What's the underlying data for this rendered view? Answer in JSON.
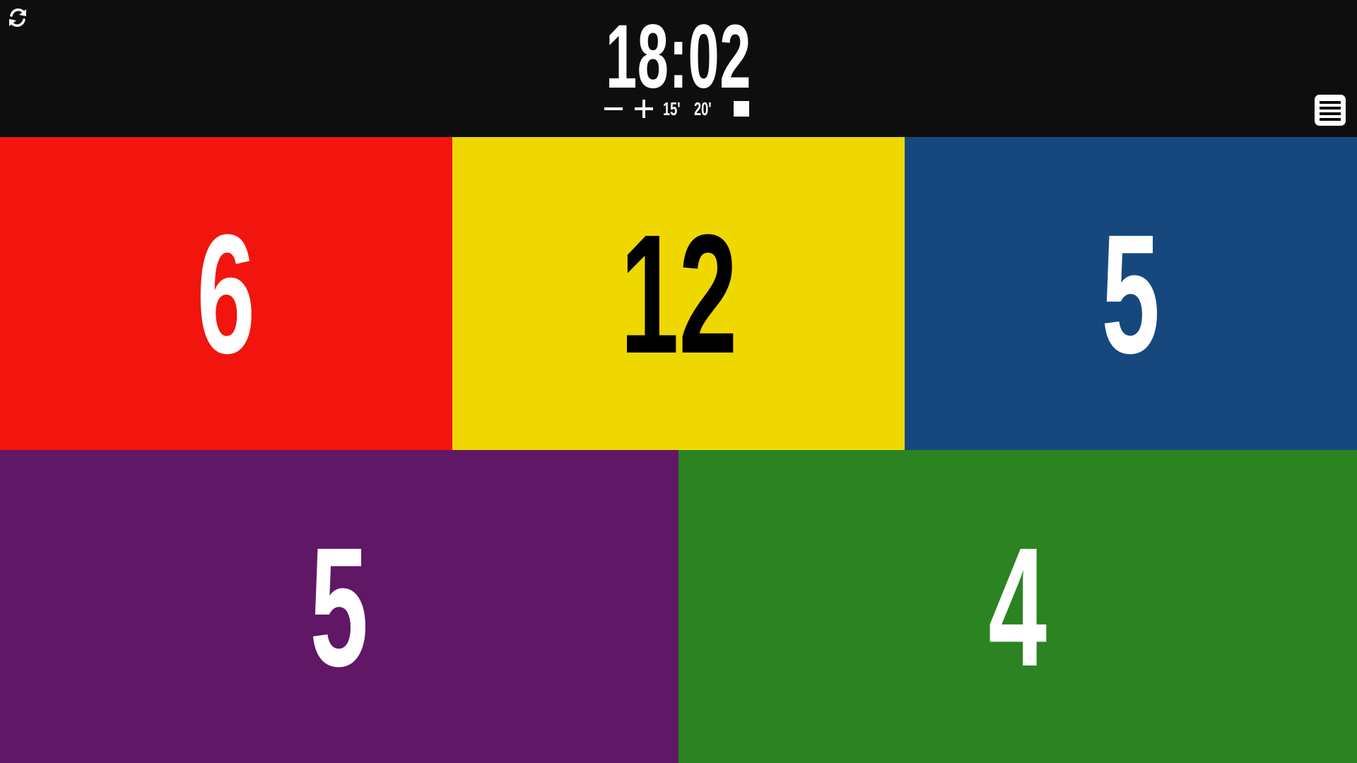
{
  "header": {
    "clock": "18:02",
    "controls": {
      "minus_icon": "minus-icon",
      "plus_icon": "plus-icon",
      "preset_15": "15'",
      "preset_20": "20'",
      "stop_icon": "stop-square-icon"
    },
    "swap_icon": "swap-arrows-icon",
    "menu_icon": "menu-list-icon"
  },
  "scores": [
    {
      "value": "6",
      "background": "#f2150d",
      "text_color": "#ffffff"
    },
    {
      "value": "12",
      "background": "#eed800",
      "text_color": "#000000"
    },
    {
      "value": "5",
      "background": "#16487e",
      "text_color": "#ffffff"
    },
    {
      "value": "5",
      "background": "#601766",
      "text_color": "#ffffff"
    },
    {
      "value": "4",
      "background": "#2b8321",
      "text_color": "#ffffff"
    }
  ]
}
